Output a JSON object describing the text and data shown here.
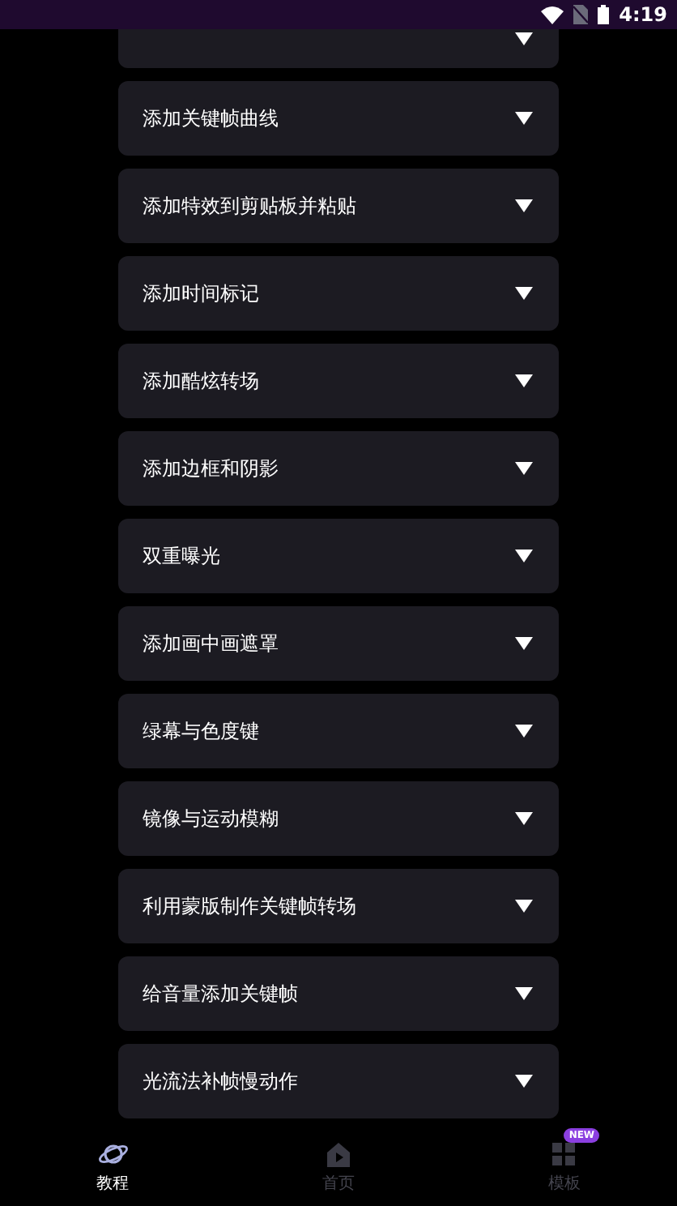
{
  "status_bar": {
    "time": "4:19"
  },
  "tutorials": [
    {
      "partial": true,
      "expanded": false
    },
    {
      "title": "添加关键帧曲线",
      "expanded": false
    },
    {
      "title": "添加特效到剪贴板并粘贴",
      "expanded": false
    },
    {
      "title": "添加时间标记",
      "expanded": false
    },
    {
      "title": "添加酷炫转场",
      "expanded": false
    },
    {
      "title": "添加边框和阴影",
      "expanded": false
    },
    {
      "title": "双重曝光",
      "expanded": false
    },
    {
      "title": "添加画中画遮罩",
      "expanded": false
    },
    {
      "title": "绿幕与色度键",
      "expanded": false
    },
    {
      "title": "镜像与运动模糊",
      "expanded": false
    },
    {
      "title": "利用蒙版制作关键帧转场",
      "expanded": false
    },
    {
      "title": "给音量添加关键帧",
      "expanded": false
    },
    {
      "title": "光流法补帧慢动作",
      "expanded": false
    }
  ],
  "bottom_nav": [
    {
      "kind": "planet",
      "label": "教程",
      "selected": true
    },
    {
      "kind": "home",
      "label": "首页",
      "selected": false
    },
    {
      "kind": "grid",
      "label": "模板",
      "selected": false,
      "badge": "NEW"
    }
  ]
}
